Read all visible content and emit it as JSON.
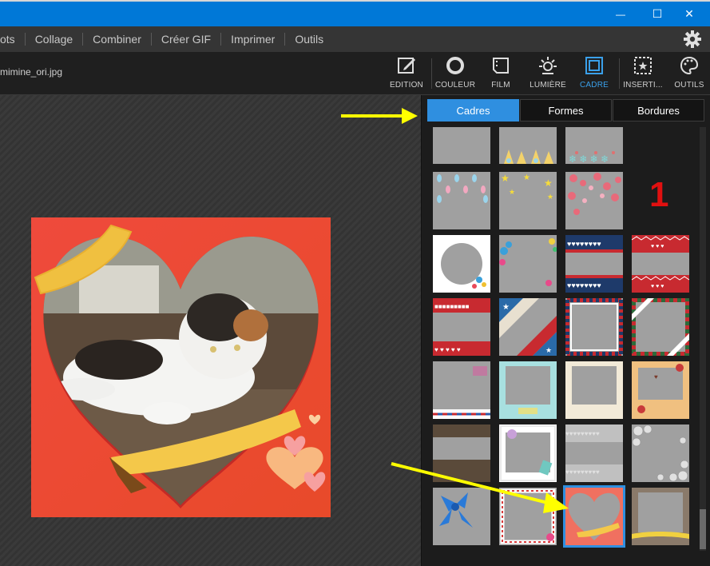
{
  "window": {
    "minimize_glyph": "—",
    "maximize_glyph": "☐",
    "close_glyph": "✕"
  },
  "menu": {
    "items": [
      "ots",
      "Collage",
      "Combiner",
      "Créer GIF",
      "Imprimer",
      "Outils"
    ]
  },
  "file": {
    "name": "mimine_ori.jpg"
  },
  "toolbar": {
    "tools": [
      {
        "label": "EDITION",
        "icon": "edit-icon"
      },
      {
        "label": "COULEUR",
        "icon": "color-circle-icon"
      },
      {
        "label": "FILM",
        "icon": "film-icon"
      },
      {
        "label": "LUMIÈRE",
        "icon": "light-icon"
      },
      {
        "label": "CADRE",
        "icon": "frame-icon",
        "active": true
      },
      {
        "label": "INSERTI...",
        "icon": "insert-icon"
      },
      {
        "label": "OUTILS",
        "icon": "palette-icon"
      }
    ]
  },
  "tabs": {
    "cadres": "Cadres",
    "formes": "Formes",
    "bordures": "Bordures"
  },
  "annotation": {
    "number": "1"
  },
  "colors": {
    "accent": "#2f8fe0",
    "titlebar": "#0078d7",
    "annotation": "#e01010",
    "arrow": "#ffff00"
  }
}
